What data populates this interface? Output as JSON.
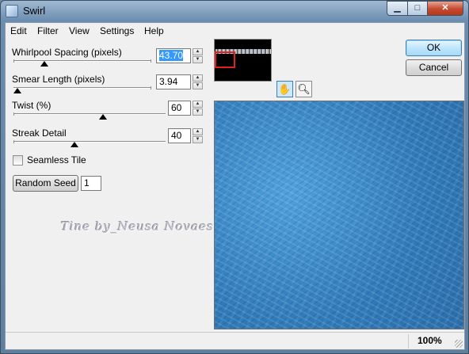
{
  "window": {
    "title": "Swirl",
    "minimize_glyph": "▁",
    "maximize_glyph": "□",
    "close_glyph": "✕"
  },
  "menu": [
    "Edit",
    "Filter",
    "View",
    "Settings",
    "Help"
  ],
  "controls": {
    "whirlpool_spacing": {
      "label": "Whirlpool Spacing (pixels)",
      "value": "43.70",
      "selected": true
    },
    "smear_length": {
      "label": "Smear Length (pixels)",
      "value": "3.94"
    },
    "twist": {
      "label": "Twist (%)",
      "value": "60"
    },
    "streak_detail": {
      "label": "Streak Detail",
      "value": "40"
    },
    "seamless_tile": {
      "label": "Seamless Tile",
      "checked": false
    },
    "random_seed": {
      "button_label": "Random Seed",
      "value": "1"
    }
  },
  "spinner_glyphs": {
    "up": "▲",
    "down": "▼"
  },
  "buttons": {
    "ok": "OK",
    "cancel": "Cancel"
  },
  "watermark": "Tine by_Neusa Novaes",
  "tools": {
    "pan": "pan-hand-icon",
    "zoom": "zoom-magnifier-icon",
    "pan_glyph": "✋",
    "zoom_glyph": "🔍︎"
  },
  "status": {
    "zoom": "100%"
  },
  "colors": {
    "preview_blue": "#2f79b8",
    "nav_rect": "#e02020",
    "default_button": "#3c7fb1"
  }
}
